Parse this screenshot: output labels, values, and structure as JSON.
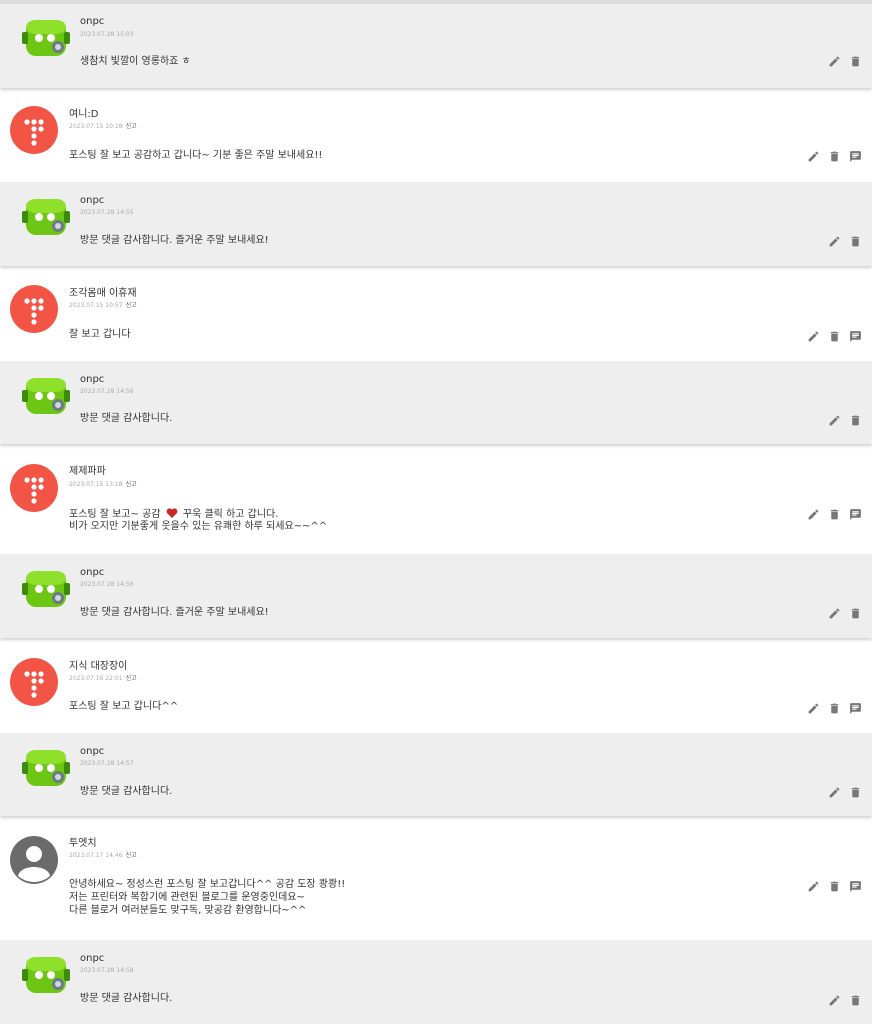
{
  "comments": [
    {
      "type": "reply",
      "author": "onpc",
      "date": "2023.07.28 15:03",
      "report_label": "",
      "lines": [
        "생참치 빛깔이 영롱하죠 ㅎ"
      ]
    },
    {
      "type": "comment",
      "author": "여니:D",
      "date": "2023.07.15 10:18",
      "report_label": "신고",
      "lines": [
        "포스팅 잘 보고 공감하고 갑니다~ 기분 좋은 주말 보내세요!!"
      ]
    },
    {
      "type": "reply",
      "author": "onpc",
      "date": "2023.07.28 14:55",
      "report_label": "",
      "lines": [
        "방문 댓글 감사합니다. 즐거운 주말 보내세요!"
      ]
    },
    {
      "type": "comment",
      "author": "조각몸매 이휴재",
      "date": "2023.07.15 10:57",
      "report_label": "신고",
      "lines": [
        "잘 보고 갑니다"
      ]
    },
    {
      "type": "reply",
      "author": "onpc",
      "date": "2023.07.28 14:56",
      "report_label": "",
      "lines": [
        "방문 댓글 감사합니다."
      ]
    },
    {
      "type": "comment",
      "author": "제제파파",
      "date": "2023.07.15 13:18",
      "report_label": "신고",
      "lines": [
        "포스팅 잘 보고~ 공감",
        "비가 오지만 기분좋게 웃을수 있는 유쾌한 하루 되세요~~^^"
      ],
      "heart_after": "꾸욱 클릭 하고 갑니다."
    },
    {
      "type": "reply",
      "author": "onpc",
      "date": "2023.07.28 14:56",
      "report_label": "",
      "lines": [
        "방문 댓글 감사합니다. 즐거운 주말 보내세요!"
      ]
    },
    {
      "type": "comment",
      "author": "지식 대장장이",
      "date": "2023.07.16 22:01",
      "report_label": "신고",
      "lines": [
        "포스팅 잘 보고 갑니다^^"
      ]
    },
    {
      "type": "reply",
      "author": "onpc",
      "date": "2023.07.28 14:57",
      "report_label": "",
      "lines": [
        "방문 댓글 감사합니다."
      ]
    },
    {
      "type": "comment",
      "author": "투엣치",
      "date": "2023.07.17 14:46",
      "report_label": "신고",
      "lines": [
        "안녕하세요~ 정성스런 포스팅 잘 보고갑니다^^ 공감 도장 쾅쾅!!",
        "저는 프린터와 복합기에 관련된 블로그를 운영중인데요~",
        "다른 블로거 여러분들도 맞구독, 맞공감 환영합니다~^^"
      ]
    },
    {
      "type": "reply",
      "author": "onpc",
      "date": "2023.07.28 14:58",
      "report_label": "",
      "lines": [
        "방문 댓글 감사합니다."
      ]
    }
  ],
  "icons": {
    "edit": "pencil-icon",
    "delete": "trash-icon",
    "reply": "comment-icon",
    "heart": "heart-icon"
  },
  "colors": {
    "reply_bg": "#eeeeee",
    "tistory_red": "#f25545",
    "robot_green": "#6cc613",
    "icon_gray": "#777777",
    "heart": "#c62828"
  }
}
